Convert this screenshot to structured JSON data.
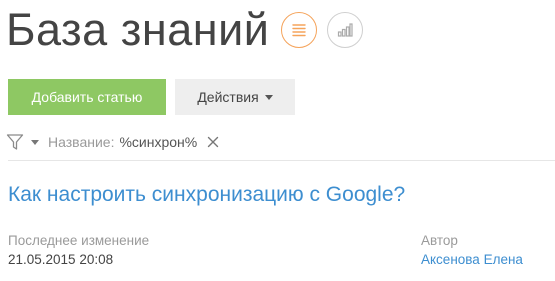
{
  "page": {
    "title": "База знаний"
  },
  "views": [
    {
      "icon": "list-view-icon",
      "active": true
    },
    {
      "icon": "analytics-view-icon",
      "active": false
    }
  ],
  "toolbar": {
    "add_label": "Добавить статью",
    "actions_label": "Действия"
  },
  "filter": {
    "label": "Название:",
    "value": "%синхрон%"
  },
  "article": {
    "title": "Как настроить синхронизацию с Google?",
    "modified_label": "Последнее изменение",
    "modified_value": "21.05.2015 20:08",
    "author_label": "Автор",
    "author_value": "Аксенова Елена"
  },
  "colors": {
    "accent_blue": "#3d8ed0",
    "button_green": "#8ec863",
    "active_view_orange": "#f5a35a"
  }
}
